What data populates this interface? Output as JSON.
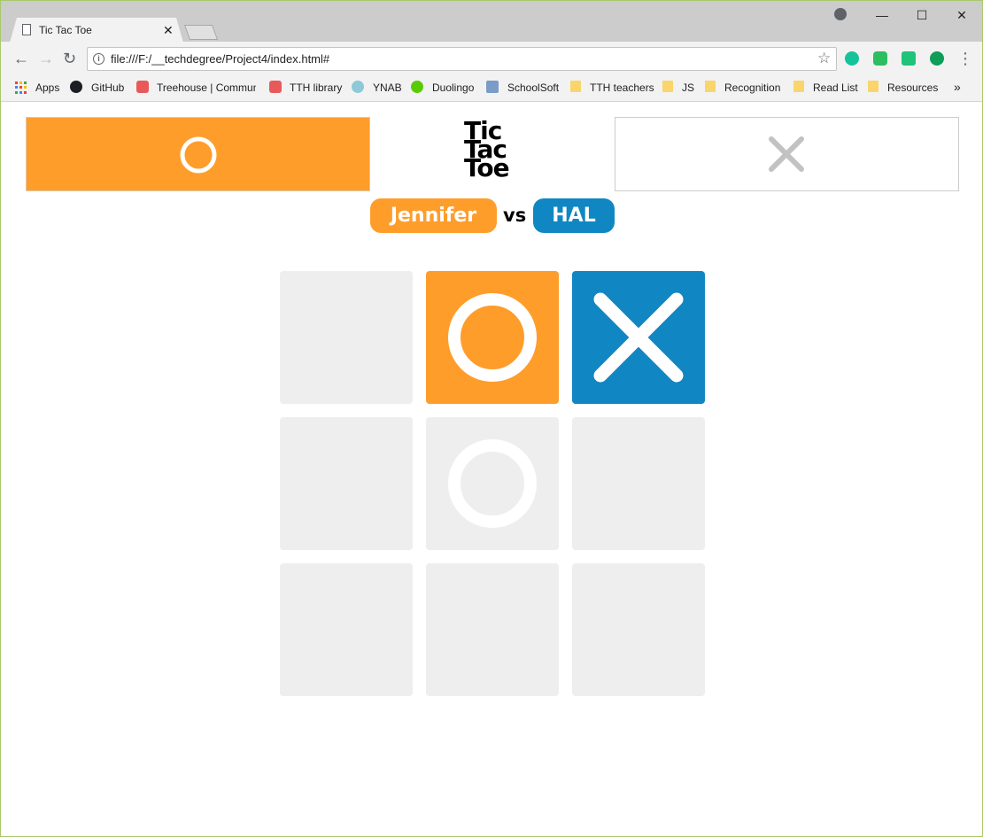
{
  "browser": {
    "tab_title": "Tic Tac Toe",
    "tab_close": "✕",
    "window_controls": {
      "minimize": "—",
      "maximize": "☐",
      "close": "✕"
    },
    "nav": {
      "back": "←",
      "forward": "→",
      "reload": "↻"
    },
    "url": "file:///F:/__techdegree/Project4/index.html#",
    "star": "☆",
    "menu": "⋮",
    "bookmarks": [
      {
        "label": "Apps",
        "icon": "apps-grid-icon"
      },
      {
        "label": "GitHub",
        "icon": "github-icon"
      },
      {
        "label": "Treehouse | Commun",
        "icon": "treehouse-icon"
      },
      {
        "label": "TTH library",
        "icon": "treehouse-icon"
      },
      {
        "label": "YNAB",
        "icon": "tree-icon"
      },
      {
        "label": "Duolingo",
        "icon": "owl-icon"
      },
      {
        "label": "SchoolSoft",
        "icon": "schoolsoft-icon"
      },
      {
        "label": "TTH teachers",
        "icon": "folder-icon"
      },
      {
        "label": "JS",
        "icon": "folder-icon"
      },
      {
        "label": "Recognition",
        "icon": "folder-icon"
      },
      {
        "label": "Read List",
        "icon": "folder-icon"
      },
      {
        "label": "Resources",
        "icon": "folder-icon"
      }
    ],
    "bookmarks_overflow": "»"
  },
  "game": {
    "logo_lines": [
      "Tic",
      "Tac",
      "Toe"
    ],
    "player1": {
      "name": "Jennifer",
      "symbol": "O",
      "active": true
    },
    "vs": "vs",
    "player2": {
      "name": "HAL",
      "symbol": "X",
      "active": false
    },
    "board": [
      "",
      "O",
      "X",
      "",
      "o-hover",
      "",
      "",
      "",
      ""
    ],
    "colors": {
      "orange": "#ff9d2b",
      "blue": "#1087c3",
      "empty_cell": "#eeeeee",
      "inactive_symbol": "#c2c2c2"
    }
  }
}
